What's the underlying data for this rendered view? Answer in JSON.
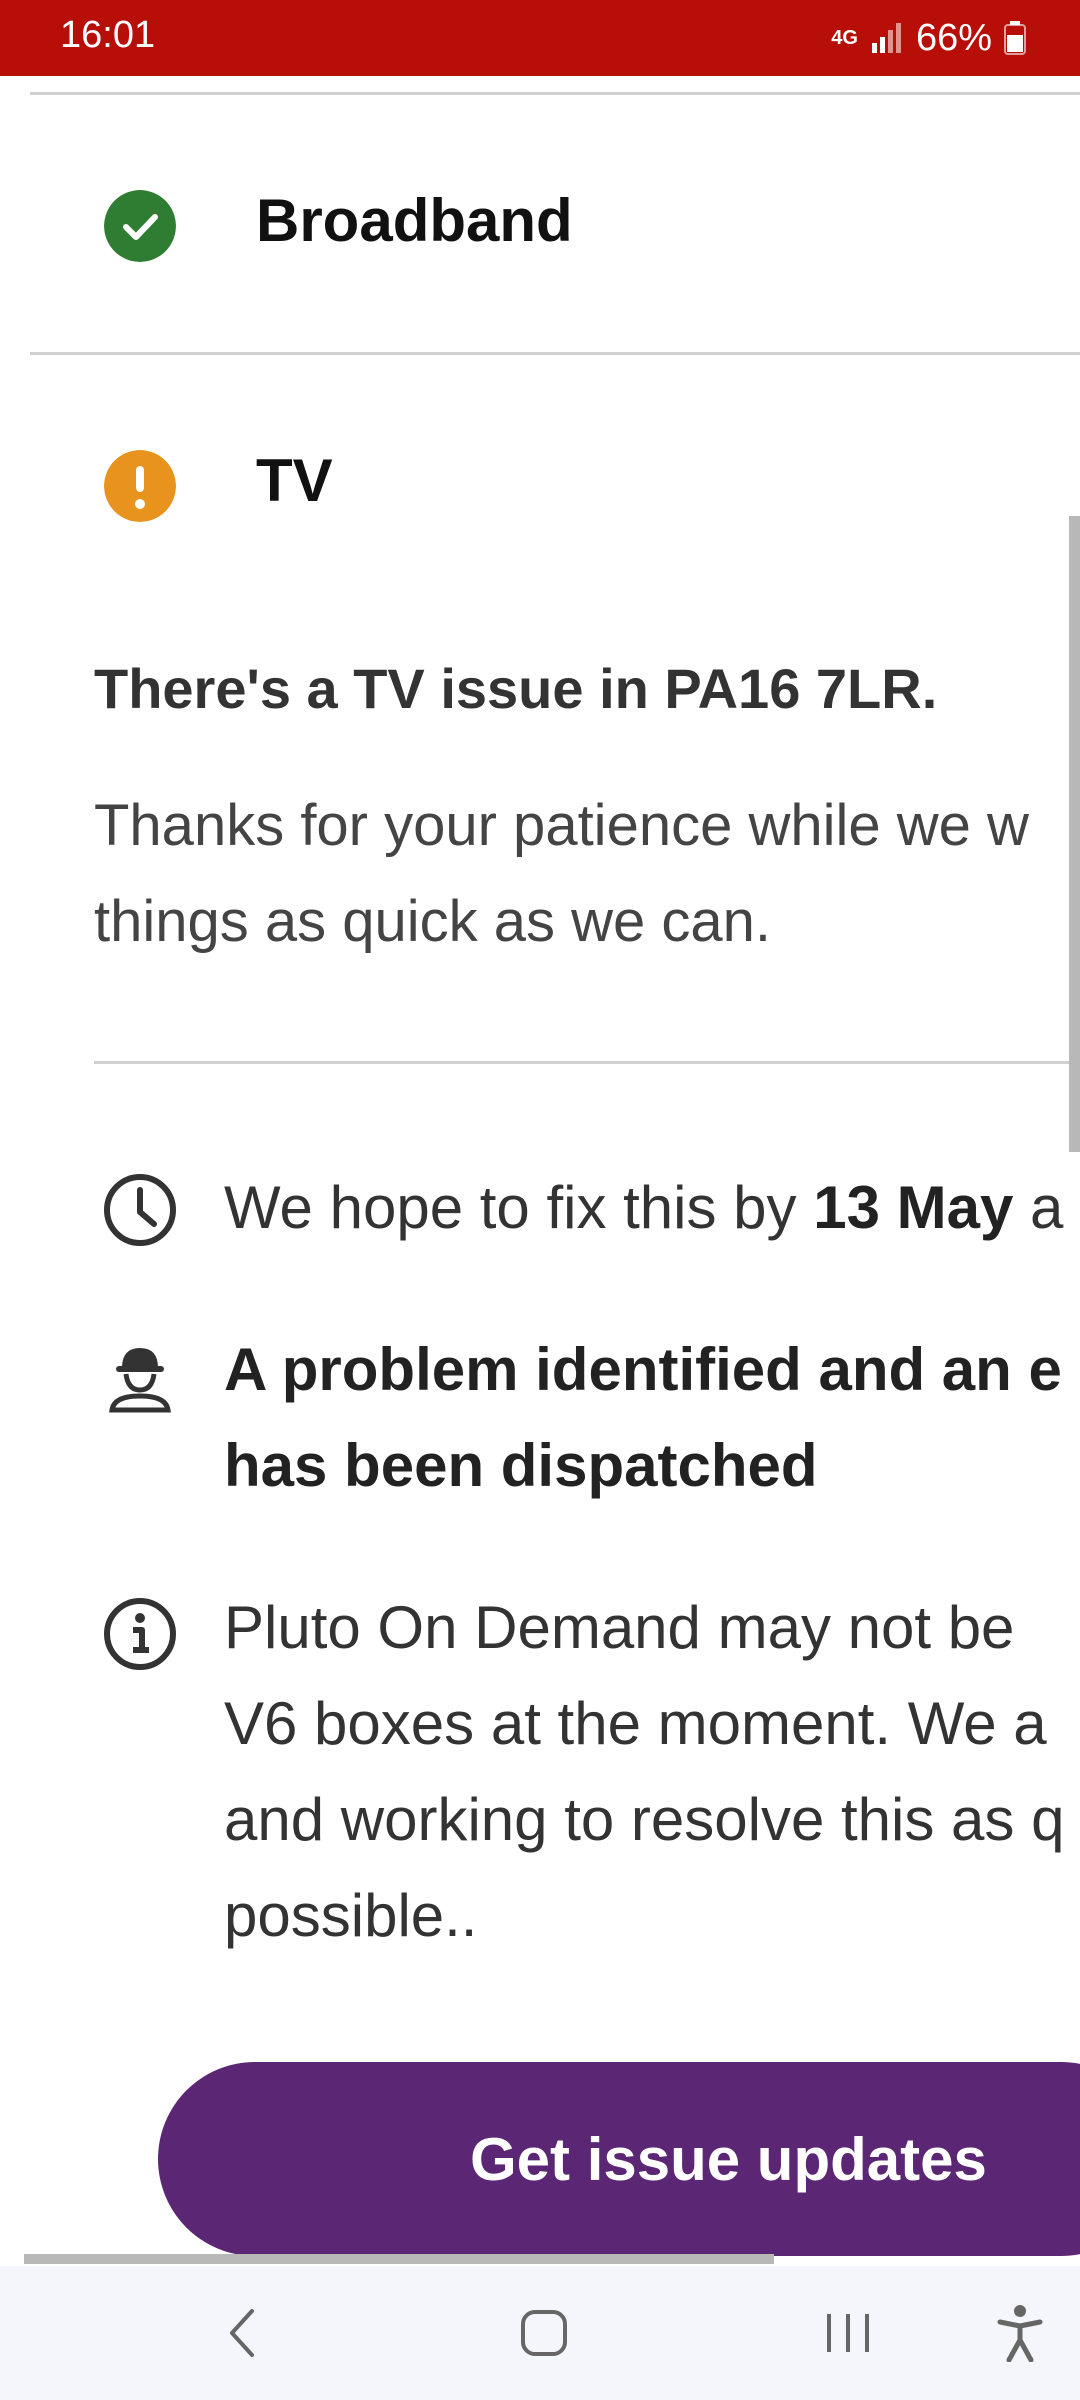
{
  "status_bar": {
    "time": "16:01",
    "network": "4G",
    "battery": "66%",
    "icons": [
      "network-4g-icon",
      "signal-icon",
      "battery-icon"
    ]
  },
  "services": [
    {
      "name": "Broadband",
      "status": "ok",
      "icon": "check-circle-icon",
      "color": "#2e7d32"
    },
    {
      "name": "TV",
      "status": "issue",
      "icon": "alert-circle-icon",
      "color": "#e8931e"
    }
  ],
  "issue": {
    "title": "There's a TV issue in PA16 7LR.",
    "description": "Thanks for your patience while we w things as quick as we can."
  },
  "details": {
    "eta_prefix": "We hope to fix this by ",
    "eta_date": "13 May",
    "eta_suffix": " a",
    "engineer_line1": "A problem identified and an e",
    "engineer_line2": "has been dispatched",
    "info_line1": "Pluto On Demand may not be",
    "info_line2": "V6 boxes at the moment. We a",
    "info_line3": "and working to resolve this as q",
    "info_line4": "possible..",
    "icons": [
      "clock-icon",
      "engineer-icon",
      "info-icon"
    ]
  },
  "cta": {
    "label": "Get issue updates",
    "color": "#5b2674"
  },
  "nav": {
    "icons": [
      "back-icon",
      "home-icon",
      "recents-icon",
      "accessibility-icon"
    ]
  },
  "colors": {
    "status_bar": "#b80e08",
    "ok": "#2e7d32",
    "warning": "#e8931e",
    "brand": "#5b2674"
  }
}
